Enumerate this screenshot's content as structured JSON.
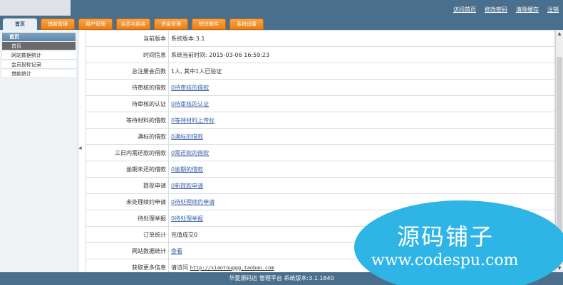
{
  "header": {
    "links": [
      "访问首页",
      "修改密码",
      "清除缓存",
      "注销"
    ],
    "tabs": [
      "首页",
      "借款管理",
      "用户管理",
      "会员与报名",
      "资金管理",
      "短信邮件",
      "系统设置"
    ]
  },
  "sidebar": {
    "title": "首页",
    "items": [
      "首页",
      "网站数据统计",
      "会员投标记录",
      "借款统计"
    ]
  },
  "rows": [
    {
      "label": "当前版本",
      "value": "系统版本:3.1"
    },
    {
      "label": "时间信息",
      "value": "系统当前时间: 2015-03-06 16:59:23"
    },
    {
      "label": "总注册会员数",
      "value": "1人, 其中1人已验证"
    },
    {
      "label": "待审核的借款",
      "link": "0待审核的借款"
    },
    {
      "label": "待审核的认证",
      "link": "0待审核的认证"
    },
    {
      "label": "等待材料的借款",
      "link": "0等待材料上传标"
    },
    {
      "label": "满标的借款",
      "link": "0满标的借款"
    },
    {
      "label": "三日内需还款的借款",
      "link": "0需还款的借款"
    },
    {
      "label": "逾期未还的借款",
      "link": "0逾期的借款"
    },
    {
      "label": "提现申请",
      "link": "0新提款申请"
    },
    {
      "label": "未处理续约申请",
      "link": "0待处理续约申请"
    },
    {
      "label": "待处理举报",
      "link": "0待处理举报"
    },
    {
      "label": "订单统计",
      "value": "充值成交0"
    },
    {
      "label": "网站数据统计",
      "link": "查看"
    },
    {
      "label": "获取更多信息",
      "value": "请访问",
      "mono": "http://xiaotouggg.taobao.com"
    }
  ],
  "footer": {
    "text": "华夏源码店 管理平台 系统版本:3.1.1840"
  },
  "watermark": {
    "cn": "源码铺子",
    "en": "www.codespu.com"
  },
  "colors": {
    "header": "#4a6f8c",
    "tab_orange": "#ec7f12",
    "watermark": "#2eb5e6",
    "link": "#3a62a8"
  }
}
